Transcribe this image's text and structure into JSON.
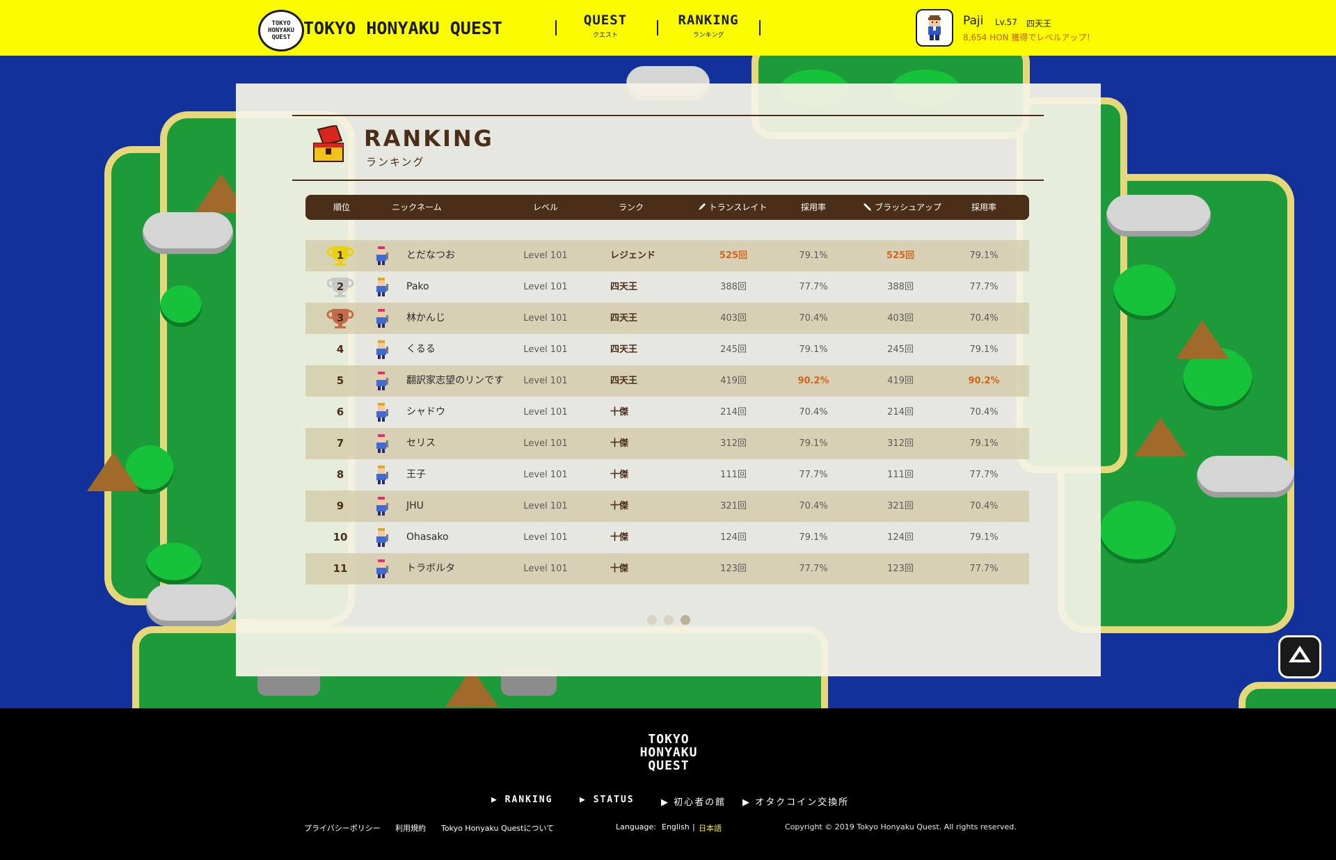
{
  "header": {
    "logo_badge": "TOKYO HONYAKU QUEST",
    "logo_text": "TOKYO HONYAKU QUEST",
    "nav": [
      {
        "en": "QUEST",
        "jp": "クエスト"
      },
      {
        "en": "RANKING",
        "jp": "ランキング"
      }
    ],
    "user": {
      "name": "Paji",
      "level": "Lv.57",
      "rank": "四天王",
      "hint": "8,654 HON 獲得でレベルアップ！"
    }
  },
  "ranking": {
    "title_en": "RANKING",
    "title_jp": "ランキング",
    "columns": [
      "順位",
      "ニックネーム",
      "レベル",
      "ランク",
      "トランスレイト",
      "採用率",
      "ブラッシュアップ",
      "採用率"
    ],
    "rows": [
      {
        "rank": "1",
        "name": "とだなつお",
        "level": "Level 101",
        "rank_name": "レジェンド",
        "translate": "525回",
        "rate1": "79.1%",
        "brushup": "525回",
        "rate2": "79.1%",
        "trophy": "gold",
        "avatar_color": "#d9317a"
      },
      {
        "rank": "2",
        "name": "Pako",
        "level": "Level 101",
        "rank_name": "四天王",
        "translate": "388回",
        "rate1": "77.7%",
        "brushup": "388回",
        "rate2": "77.7%",
        "trophy": "silver",
        "avatar_color": "#e0a820"
      },
      {
        "rank": "3",
        "name": "林かんじ",
        "level": "Level 101",
        "rank_name": "四天王",
        "translate": "403回",
        "rate1": "70.4%",
        "brushup": "403回",
        "rate2": "70.4%",
        "trophy": "bronze",
        "avatar_color": "#d9317a"
      },
      {
        "rank": "4",
        "name": "くるる",
        "level": "Level 101",
        "rank_name": "四天王",
        "translate": "245回",
        "rate1": "79.1%",
        "brushup": "245回",
        "rate2": "79.1%",
        "trophy": "",
        "avatar_color": "#e0a820"
      },
      {
        "rank": "5",
        "name": "翻訳家志望のリンです",
        "level": "Level 101",
        "rank_name": "四天王",
        "translate": "419回",
        "rate1": "90.2%",
        "brushup": "419回",
        "rate2": "90.2%",
        "trophy": "",
        "avatar_color": "#d9317a"
      },
      {
        "rank": "6",
        "name": "シャドウ",
        "level": "Level 101",
        "rank_name": "十傑",
        "translate": "214回",
        "rate1": "70.4%",
        "brushup": "214回",
        "rate2": "70.4%",
        "trophy": "",
        "avatar_color": "#e0a820"
      },
      {
        "rank": "7",
        "name": "セリス",
        "level": "Level 101",
        "rank_name": "十傑",
        "translate": "312回",
        "rate1": "79.1%",
        "brushup": "312回",
        "rate2": "79.1%",
        "trophy": "",
        "avatar_color": "#d9317a"
      },
      {
        "rank": "8",
        "name": "王子",
        "level": "Level 101",
        "rank_name": "十傑",
        "translate": "111回",
        "rate1": "77.7%",
        "brushup": "111回",
        "rate2": "77.7%",
        "trophy": "",
        "avatar_color": "#e0a820"
      },
      {
        "rank": "9",
        "name": "JHU",
        "level": "Level 101",
        "rank_name": "十傑",
        "translate": "321回",
        "rate1": "70.4%",
        "brushup": "321回",
        "rate2": "70.4%",
        "trophy": "",
        "avatar_color": "#d9317a"
      },
      {
        "rank": "10",
        "name": "Ohasako",
        "level": "Level 101",
        "rank_name": "十傑",
        "translate": "124回",
        "rate1": "79.1%",
        "brushup": "124回",
        "rate2": "79.1%",
        "trophy": "",
        "avatar_color": "#e0a820"
      },
      {
        "rank": "11",
        "name": "トラボルタ",
        "level": "Level 101",
        "rank_name": "十傑",
        "translate": "123回",
        "rate1": "77.7%",
        "brushup": "123回",
        "rate2": "77.7%",
        "trophy": "",
        "avatar_color": "#d9317a"
      }
    ],
    "highlight_color": "#d0641a"
  },
  "footer": {
    "logo": "TOKYO HONYAKU QUEST",
    "nav": [
      "RANKING",
      "STATUS",
      "初心者の館",
      "オタクコイン交換所"
    ],
    "links": [
      "プライバシーポリシー",
      "利用規約",
      "Tokyo Honyaku Questについて"
    ],
    "language_label": "Language:",
    "language_en": "English",
    "language_sep": "|",
    "language_jp": "日本語",
    "copyright": "Copyright © 2019 Tokyo Honyaku Quest. All rights reserved."
  },
  "colors": {
    "header_bg": "#fbfb00",
    "brown": "#4a2e17",
    "gold": "#e8d20f",
    "silver": "#c8c8c8",
    "bronze": "#c56b4a"
  }
}
